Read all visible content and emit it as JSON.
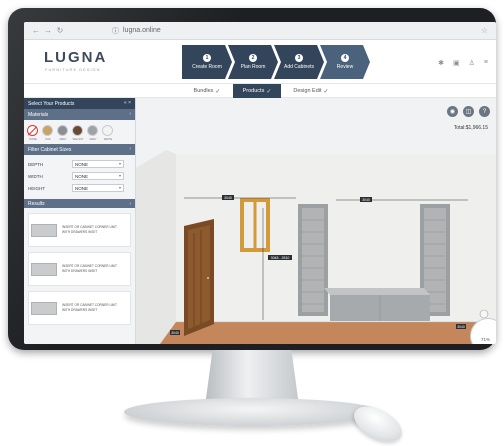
{
  "browser": {
    "back_icon": "arrow-left",
    "forward_icon": "arrow-right",
    "reload_icon": "reload",
    "url": "lugna.online"
  },
  "app": {
    "logo": "LUGNA",
    "logo_tagline": "FURNITURE DESIGN"
  },
  "steps": [
    {
      "num": "1",
      "label": "Create Room"
    },
    {
      "num": "2",
      "label": "Plan Room"
    },
    {
      "num": "3",
      "label": "Add Cabinets"
    },
    {
      "num": "4",
      "label": "Review"
    }
  ],
  "subtabs": [
    {
      "label": "Bundles",
      "active": false
    },
    {
      "label": "Products",
      "active": true
    },
    {
      "label": "Design Edit",
      "active": false
    }
  ],
  "sidebar": {
    "select_products_title": "Select Your Products",
    "materials_title": "Materials",
    "swatches": [
      {
        "label": "NONE",
        "color": "#ffffff"
      },
      {
        "label": "OAK",
        "color": "#c9a266"
      },
      {
        "label": "GREY",
        "color": "#8b8f92"
      },
      {
        "label": "WALNUT",
        "color": "#6b4a33"
      },
      {
        "label": "GREY",
        "color": "#9ea3a8"
      },
      {
        "label": "WHITE",
        "color": "#f3f3f1"
      }
    ],
    "filter_title": "Filter Cabinet Sizes",
    "filters": [
      {
        "label": "DEPTH",
        "value": "NONE"
      },
      {
        "label": "WIDTH",
        "value": "NONE"
      },
      {
        "label": "HEIGHT",
        "value": "NONE"
      }
    ],
    "results_title": "Results",
    "results": [
      {
        "text": "INSERT OR CABINET CORNER UNIT WITH DRAWERS INSET"
      },
      {
        "text": "INSERT OR CABINET CORNER UNIT WITH DRAWERS INSET"
      },
      {
        "text": "INSERT OR CABINET CORNER UNIT WITH DRAWERS INSET"
      }
    ]
  },
  "main": {
    "total": "Total:$1,966.15",
    "zoom": "71%",
    "dims": {
      "top_left": "3040",
      "top_right": "3040",
      "height": "3048 - 2810",
      "door": "800",
      "floor_left": "3040",
      "floor_right": "3040"
    }
  },
  "colors": {
    "accent": "#33455a",
    "floor": "#c4865b",
    "cabinet": "#9da0a2",
    "door": "#7a4a24"
  }
}
